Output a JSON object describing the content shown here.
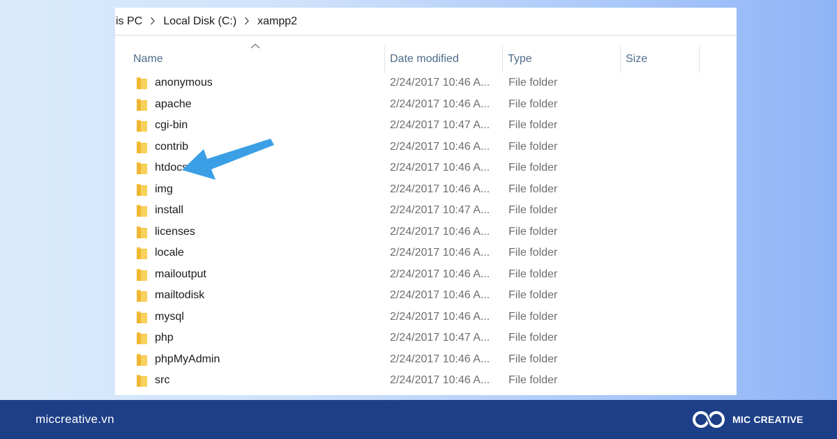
{
  "breadcrumb": {
    "items": [
      "is PC",
      "Local Disk (C:)",
      "xampp2"
    ]
  },
  "columns": {
    "name": "Name",
    "date": "Date modified",
    "type": "Type",
    "size": "Size"
  },
  "files": [
    {
      "name": "anonymous",
      "date": "2/24/2017 10:46 A...",
      "type": "File folder"
    },
    {
      "name": "apache",
      "date": "2/24/2017 10:46 A...",
      "type": "File folder"
    },
    {
      "name": "cgi-bin",
      "date": "2/24/2017 10:47 A...",
      "type": "File folder"
    },
    {
      "name": "contrib",
      "date": "2/24/2017 10:46 A...",
      "type": "File folder"
    },
    {
      "name": "htdocs",
      "date": "2/24/2017 10:46 A...",
      "type": "File folder"
    },
    {
      "name": "img",
      "date": "2/24/2017 10:46 A...",
      "type": "File folder"
    },
    {
      "name": "install",
      "date": "2/24/2017 10:47 A...",
      "type": "File folder"
    },
    {
      "name": "licenses",
      "date": "2/24/2017 10:46 A...",
      "type": "File folder"
    },
    {
      "name": "locale",
      "date": "2/24/2017 10:46 A...",
      "type": "File folder"
    },
    {
      "name": "mailoutput",
      "date": "2/24/2017 10:46 A...",
      "type": "File folder"
    },
    {
      "name": "mailtodisk",
      "date": "2/24/2017 10:46 A...",
      "type": "File folder"
    },
    {
      "name": "mysql",
      "date": "2/24/2017 10:46 A...",
      "type": "File folder"
    },
    {
      "name": "php",
      "date": "2/24/2017 10:47 A...",
      "type": "File folder"
    },
    {
      "name": "phpMyAdmin",
      "date": "2/24/2017 10:46 A...",
      "type": "File folder"
    },
    {
      "name": "src",
      "date": "2/24/2017 10:46 A...",
      "type": "File folder"
    }
  ],
  "footer": {
    "url": "miccreative.vn",
    "brand": "MIC CREATIVE"
  },
  "colors": {
    "folder": "#f6c243",
    "arrow": "#3b9fe6",
    "footer_bg": "#1d3f88",
    "header_text": "#4d6b8a"
  },
  "icons": {
    "folder": "folder-icon",
    "separator": "chevron-right-icon",
    "sort": "sort-up-icon",
    "annotation": "pointer-arrow-icon",
    "logo": "mic-logo-icon"
  }
}
